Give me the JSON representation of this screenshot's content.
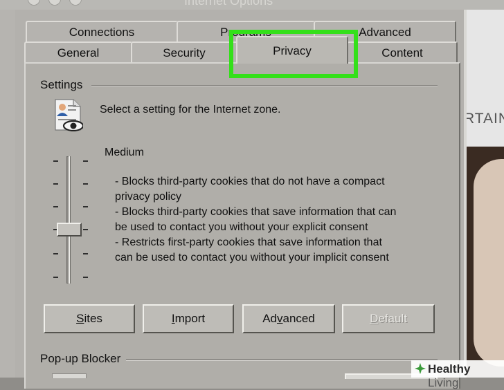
{
  "window": {
    "title": "Internet Options"
  },
  "tabs": {
    "row1": [
      "Connections",
      "Programs",
      "Advanced"
    ],
    "row2": [
      "General",
      "Security",
      "Privacy",
      "Content"
    ],
    "selected": "Privacy"
  },
  "settings": {
    "group_label": "Settings",
    "prompt": "Select a setting for the Internet zone.",
    "level": "Medium",
    "slider_level_fraction": 0.5,
    "description": [
      "- Blocks third-party cookies that do not have a compact",
      "privacy policy",
      "- Blocks third-party cookies that save information that can",
      "be used to contact you without your explicit consent",
      "- Restricts first-party cookies that save information that",
      "can be used to contact you without your implicit consent"
    ]
  },
  "buttons": {
    "sites": {
      "label": "Sites",
      "accel": "S",
      "rest": "ites"
    },
    "import": {
      "label": "Import",
      "accel": "I",
      "rest": "mport"
    },
    "advanced": {
      "label": "Advanced",
      "pre": "Ad",
      "accel": "v",
      "rest": "anced"
    },
    "default": {
      "label": "Default",
      "accel": "D",
      "rest": "efault"
    }
  },
  "popup": {
    "group_label": "Pop-up Blocker"
  },
  "background": {
    "partial_text": "RTAIN"
  },
  "watermark": {
    "brand": "Healthy",
    "sub": "Living"
  },
  "colors": {
    "highlight": "#34e01a",
    "dialog": "#b3b1ad"
  }
}
